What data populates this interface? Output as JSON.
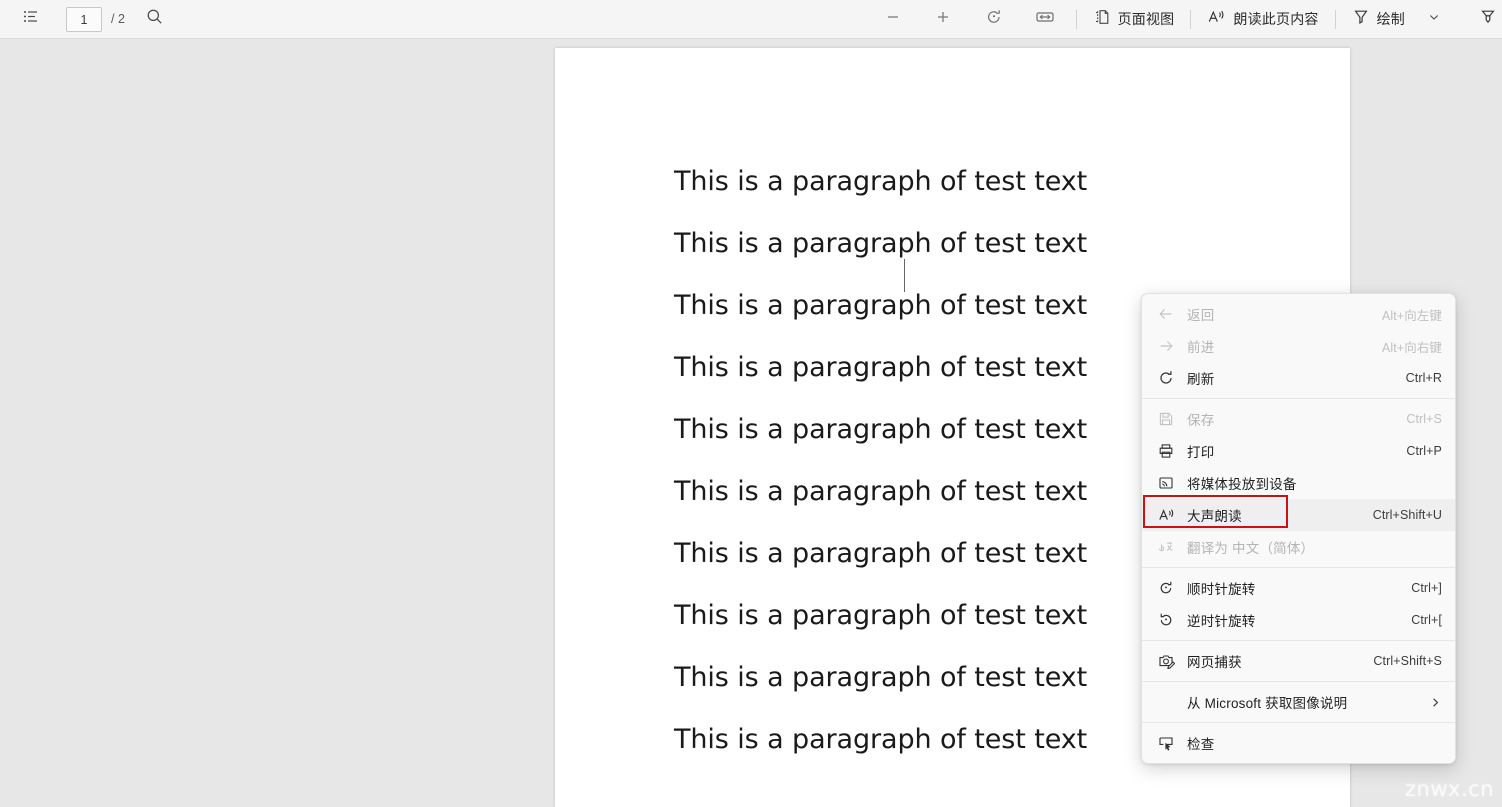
{
  "toolbar": {
    "outline_icon": "list-outline-icon",
    "page_input_value": "1",
    "page_total": "/ 2",
    "search_icon": "search-icon",
    "zoom_out_icon": "minus-icon",
    "zoom_in_icon": "plus-icon",
    "rotate_icon": "rotate-icon",
    "fit_width_icon": "fit-width-icon",
    "page_view_icon": "page-view-icon",
    "page_view_label": "页面视图",
    "read_aloud_icon": "read-aloud-icon",
    "read_aloud_label": "朗读此页内容",
    "draw_icon": "draw-pen-icon",
    "draw_label": "绘制",
    "draw_chevron_icon": "chevron-down-icon",
    "highlighter_icon": "highlighter-icon"
  },
  "document": {
    "lines": [
      "This is a paragraph of test text",
      "This is a paragraph of test text",
      "This is a paragraph of test text",
      "This is a paragraph of test text",
      "This is a paragraph of test text",
      "This is a paragraph of test text",
      "This is a paragraph of test text",
      "This is a paragraph of test text",
      "This is a paragraph of test text",
      "This is a paragraph of test text"
    ]
  },
  "watermark": {
    "text": "znwx.cn"
  },
  "context_menu": {
    "highlight_color": "#cc1111",
    "items": [
      {
        "icon": "arrow-left-icon",
        "label": "返回",
        "accel": "Alt+向左键",
        "disabled": true
      },
      {
        "icon": "arrow-right-icon",
        "label": "前进",
        "accel": "Alt+向右键",
        "disabled": true
      },
      {
        "icon": "refresh-icon",
        "label": "刷新",
        "accel": "Ctrl+R",
        "disabled": false
      },
      {
        "separator": true
      },
      {
        "icon": "save-icon",
        "label": "保存",
        "accel": "Ctrl+S",
        "disabled": true
      },
      {
        "icon": "print-icon",
        "label": "打印",
        "accel": "Ctrl+P",
        "disabled": false
      },
      {
        "icon": "cast-icon",
        "label": "将媒体投放到设备",
        "accel": "",
        "disabled": false
      },
      {
        "icon": "read-aloud-icon",
        "label": "大声朗读",
        "accel": "Ctrl+Shift+U",
        "disabled": false,
        "highlighted": true,
        "annotated": true
      },
      {
        "icon": "translate-icon",
        "label": "翻译为 中文（简体）",
        "accel": "",
        "disabled": true
      },
      {
        "separator": true
      },
      {
        "icon": "rotate-cw-icon",
        "label": "顺时针旋转",
        "accel": "Ctrl+]",
        "disabled": false
      },
      {
        "icon": "rotate-ccw-icon",
        "label": "逆时针旋转",
        "accel": "Ctrl+[",
        "disabled": false
      },
      {
        "separator": true
      },
      {
        "icon": "web-capture-icon",
        "label": "网页捕获",
        "accel": "Ctrl+Shift+S",
        "disabled": false
      },
      {
        "separator": true
      },
      {
        "icon": "none",
        "label": "从 Microsoft 获取图像说明",
        "accel": "",
        "disabled": false,
        "submenu": true
      },
      {
        "separator": true
      },
      {
        "icon": "inspect-icon",
        "label": "检查",
        "accel": "",
        "disabled": false
      }
    ]
  }
}
